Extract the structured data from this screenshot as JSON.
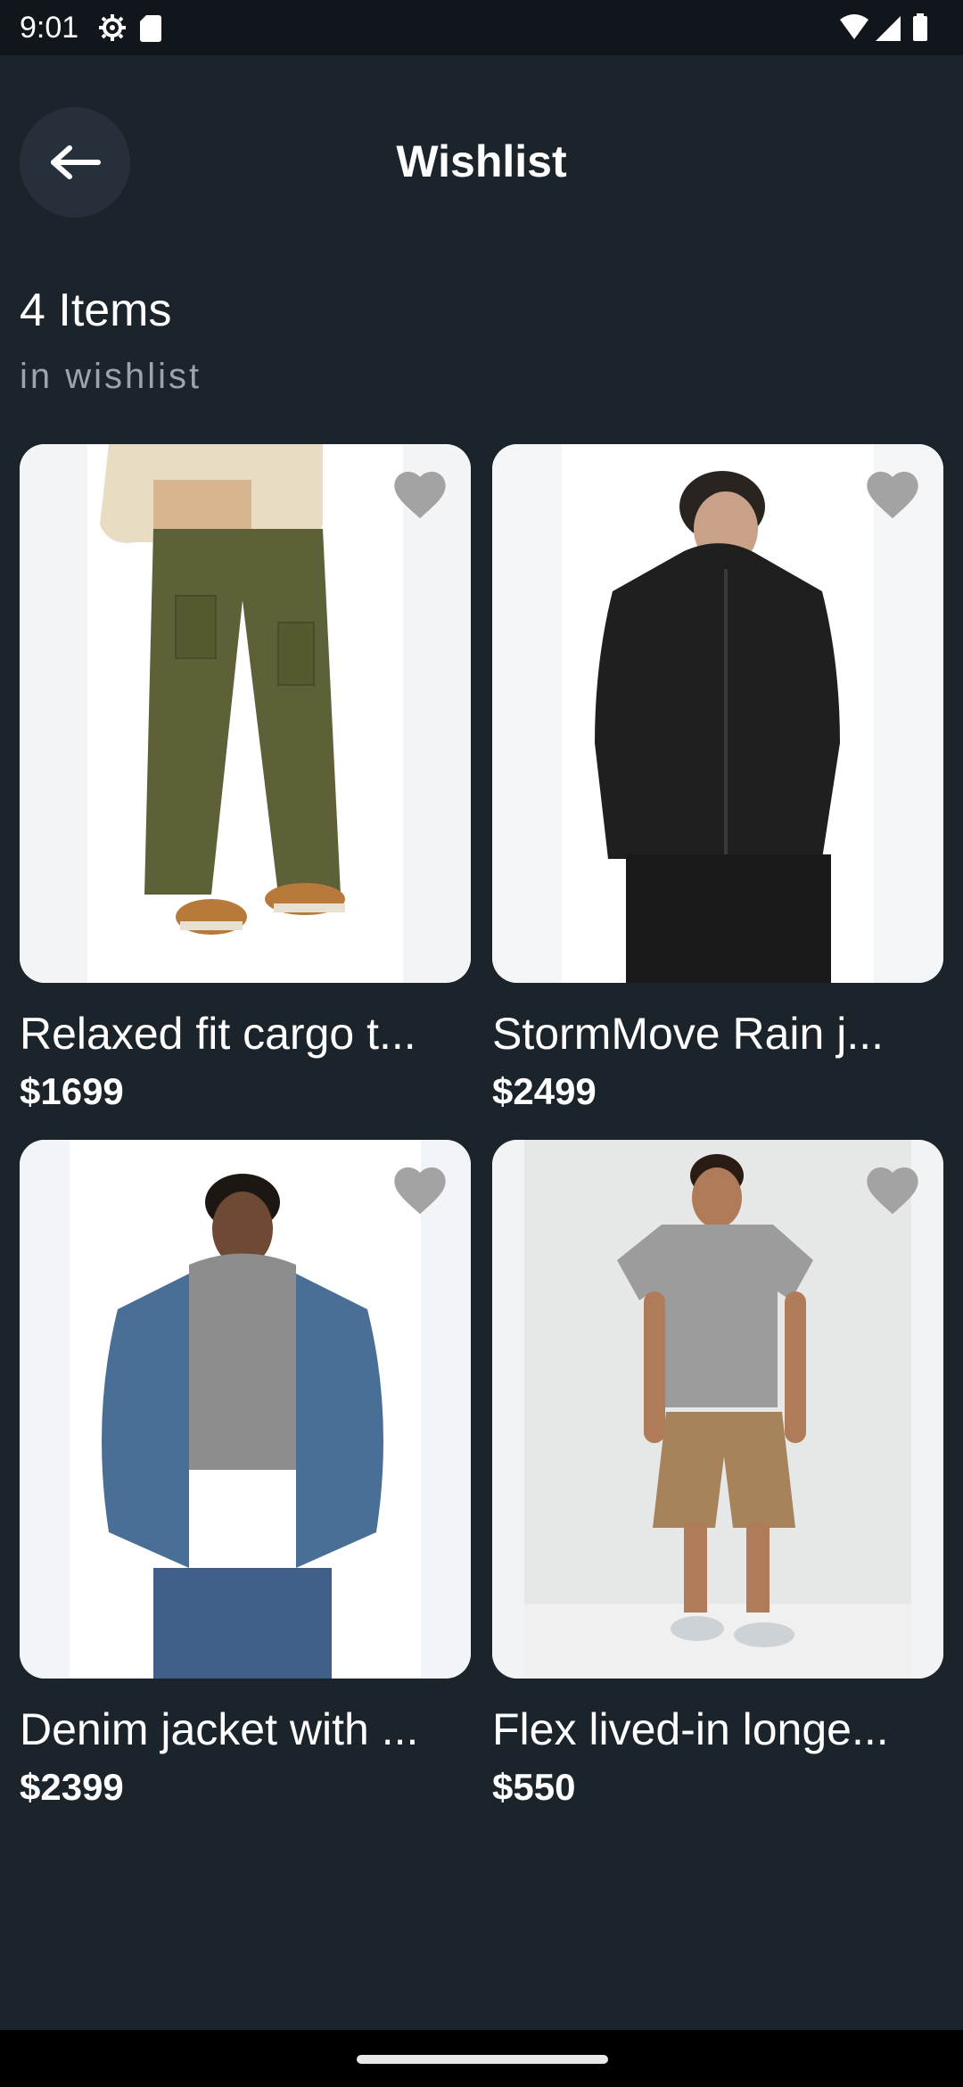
{
  "status_bar": {
    "time": "9:01"
  },
  "header": {
    "title": "Wishlist"
  },
  "summary": {
    "count": "4 Items",
    "subtitle": "in wishlist"
  },
  "items": [
    {
      "name": "Relaxed fit cargo t...",
      "price": "$1699"
    },
    {
      "name": "StormMove Rain j...",
      "price": "$2499"
    },
    {
      "name": "Denim jacket with ...",
      "price": "$2399"
    },
    {
      "name": "Flex lived-in longe...",
      "price": "$550"
    }
  ],
  "colors": {
    "background": "#1b232b",
    "status_bar": "#10161c",
    "back_button": "#26303a",
    "card_bg": "#f1f3f5",
    "heart": "#a3a3a3"
  }
}
